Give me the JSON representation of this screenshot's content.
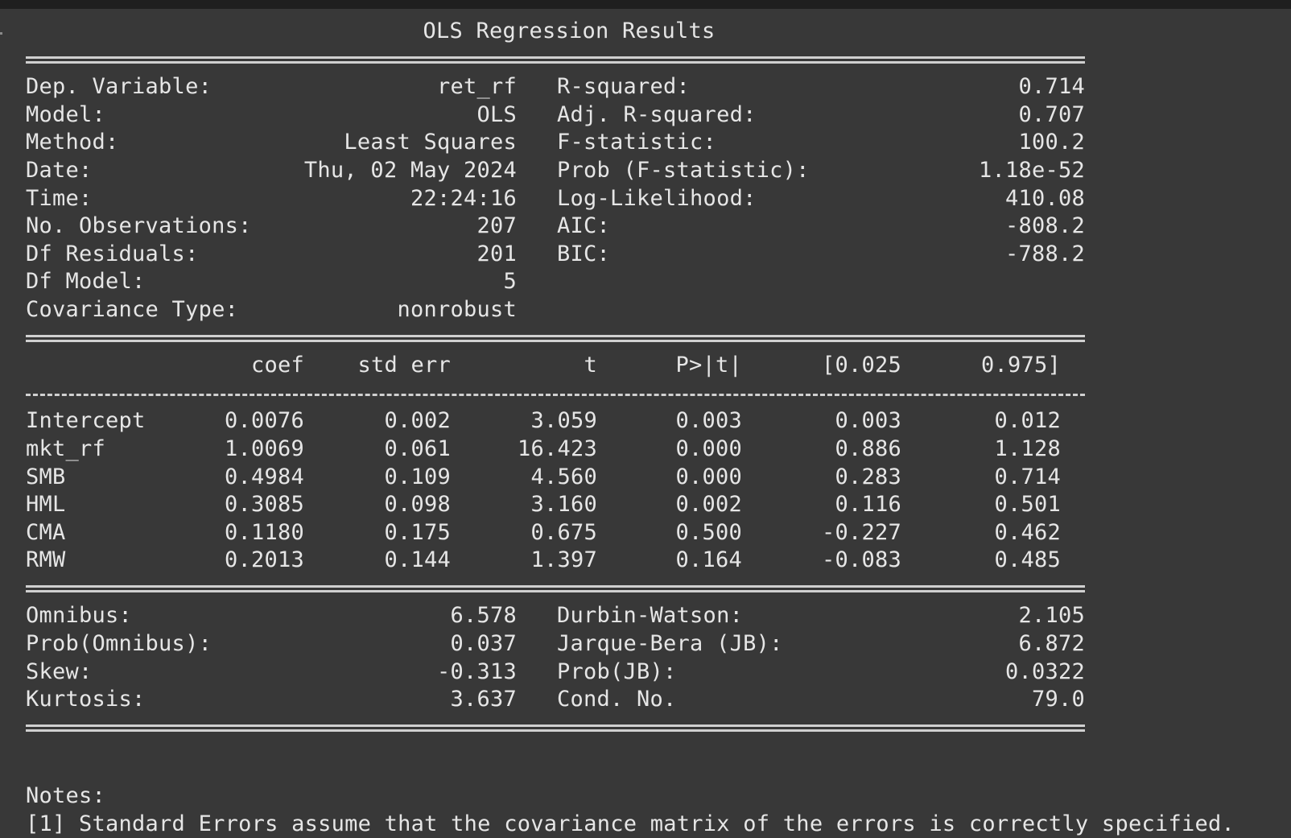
{
  "title": "OLS Regression Results",
  "info_rows": [
    {
      "l1": "Dep. Variable:",
      "v1": "ret_rf",
      "l2": "R-squared:",
      "v2": "0.714"
    },
    {
      "l1": "Model:",
      "v1": "OLS",
      "l2": "Adj. R-squared:",
      "v2": "0.707"
    },
    {
      "l1": "Method:",
      "v1": "Least Squares",
      "l2": "F-statistic:",
      "v2": "100.2"
    },
    {
      "l1": "Date:",
      "v1": "Thu, 02 May 2024",
      "l2": "Prob (F-statistic):",
      "v2": "1.18e-52"
    },
    {
      "l1": "Time:",
      "v1": "22:24:16",
      "l2": "Log-Likelihood:",
      "v2": "410.08"
    },
    {
      "l1": "No. Observations:",
      "v1": "207",
      "l2": "AIC:",
      "v2": "-808.2"
    },
    {
      "l1": "Df Residuals:",
      "v1": "201",
      "l2": "BIC:",
      "v2": "-788.2"
    },
    {
      "l1": "Df Model:",
      "v1": "5",
      "l2": "",
      "v2": ""
    },
    {
      "l1": "Covariance Type:",
      "v1": "nonrobust",
      "l2": "",
      "v2": ""
    }
  ],
  "coef_header": {
    "coef": "coef",
    "std_err": "std err",
    "t": "t",
    "p": "P>|t|",
    "lo": "[0.025",
    "hi": "0.975]"
  },
  "coef_rows": [
    {
      "name": "Intercept",
      "coef": "0.0076",
      "std_err": "0.002",
      "t": "3.059",
      "p": "0.003",
      "lo": "0.003",
      "hi": "0.012"
    },
    {
      "name": "mkt_rf",
      "coef": "1.0069",
      "std_err": "0.061",
      "t": "16.423",
      "p": "0.000",
      "lo": "0.886",
      "hi": "1.128"
    },
    {
      "name": "SMB",
      "coef": "0.4984",
      "std_err": "0.109",
      "t": "4.560",
      "p": "0.000",
      "lo": "0.283",
      "hi": "0.714"
    },
    {
      "name": "HML",
      "coef": "0.3085",
      "std_err": "0.098",
      "t": "3.160",
      "p": "0.002",
      "lo": "0.116",
      "hi": "0.501"
    },
    {
      "name": "CMA",
      "coef": "0.1180",
      "std_err": "0.175",
      "t": "0.675",
      "p": "0.500",
      "lo": "-0.227",
      "hi": "0.462"
    },
    {
      "name": "RMW",
      "coef": "0.2013",
      "std_err": "0.144",
      "t": "1.397",
      "p": "0.164",
      "lo": "-0.083",
      "hi": "0.485"
    }
  ],
  "diag_rows": [
    {
      "l1": "Omnibus:",
      "v1": "6.578",
      "l2": "Durbin-Watson:",
      "v2": "2.105"
    },
    {
      "l1": "Prob(Omnibus):",
      "v1": "0.037",
      "l2": "Jarque-Bera (JB):",
      "v2": "6.872"
    },
    {
      "l1": "Skew:",
      "v1": "-0.313",
      "l2": "Prob(JB):",
      "v2": "0.0322"
    },
    {
      "l1": "Kurtosis:",
      "v1": "3.637",
      "l2": "Cond. No.",
      "v2": "79.0"
    }
  ],
  "notes": {
    "heading": "Notes:",
    "items": [
      "[1] Standard Errors assume that the covariance matrix of the errors is correctly specified."
    ]
  },
  "colors": {
    "background": "#383838",
    "text": "#e6e6e6",
    "top_bar": "#1f1f1f"
  }
}
